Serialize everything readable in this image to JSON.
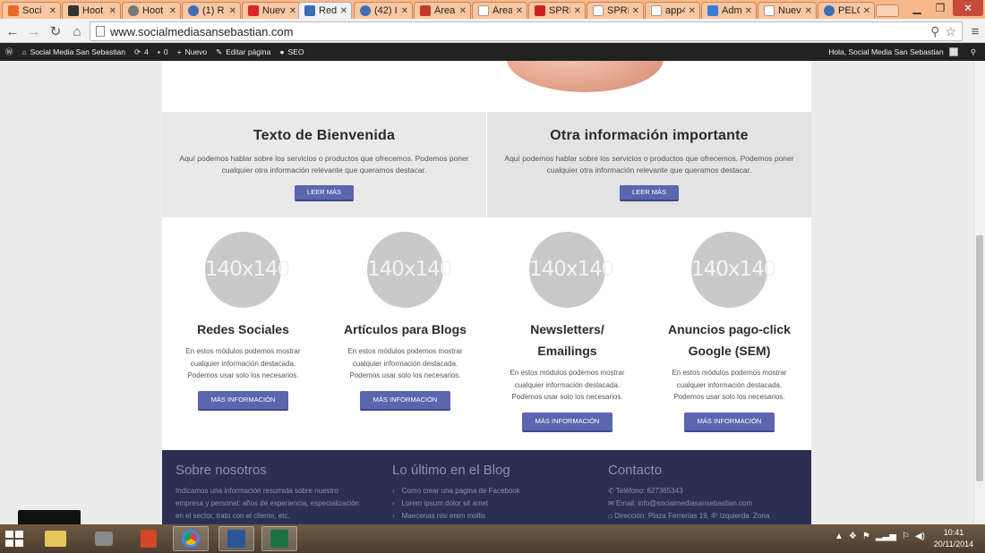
{
  "browser": {
    "tabs": [
      {
        "title": "Soci",
        "color": "#e8692b"
      },
      {
        "title": "Hoot",
        "color": "#333333"
      },
      {
        "title": "Hoot",
        "color": "#777777"
      },
      {
        "title": "(1) R",
        "color": "#3d6fb6"
      },
      {
        "title": "Nuev",
        "color": "#d9262b"
      },
      {
        "title": "Rede",
        "color": "#3d6fb6"
      },
      {
        "title": "(42) I",
        "color": "#3d6fb6"
      },
      {
        "title": "Área",
        "color": "#c0392b"
      },
      {
        "title": "Área",
        "color": "#999999"
      },
      {
        "title": "SPRI",
        "color": "#cc2222"
      },
      {
        "title": "SPRI",
        "color": "#999999"
      },
      {
        "title": "app4",
        "color": "#999999"
      },
      {
        "title": "Adm",
        "color": "#3a7bd5"
      },
      {
        "title": "Nueva p",
        "color": "#999999"
      },
      {
        "title": "PELO",
        "color": "#3d6fb6"
      }
    ],
    "url": "www.socialmediasansebastian.com"
  },
  "adminbar": {
    "site": "Social Media San Sebastian",
    "updates": "4",
    "comments": "0",
    "new": "Nuevo",
    "edit": "Editar página",
    "seo": "SEO",
    "greeting": "Hola, Social Media San Sebastian"
  },
  "intro": [
    {
      "title": "Texto de Bienvenida",
      "text": "Aquí podemos hablar sobre los servicios o productos que ofrecemos. Podemos poner cualquier otra información relevante que queramos destacar.",
      "button": "LEER MÁS"
    },
    {
      "title": "Otra información importante",
      "text": "Aquí podemos hablar sobre los servicios o productos que ofrecemos. Podemos poner cualquier otra información relevante que queramos destacar.",
      "button": "LEER MÁS"
    }
  ],
  "modules": [
    {
      "image": "140x140",
      "title": "Redes Sociales",
      "text": "En estos módulos podemos mostrar cualquier información destacada. Podemos usar solo los necesarios.",
      "button": "MÁS INFORMACIÓN"
    },
    {
      "image": "140x140",
      "title": "Artículos para Blogs",
      "text": "En estos módulos podemos mostrar cualquier información destacada. Podemos usar solo los necesarios.",
      "button": "MÁS INFORMACIÓN"
    },
    {
      "image": "140x140",
      "title": "Newsletters/ Emailings",
      "text": "En estos módulos podemos mostrar cualquier información destacada. Podemos usar solo los necesarios.",
      "button": "MÁS INFORMACIÓN"
    },
    {
      "image": "140x140",
      "title": "Anuncios pago-click Google (SEM)",
      "text": "En estos módulos podemos mostrar cualquier información destacada. Podemos usar solo los necesarios.",
      "button": "MÁS INFORMACIÓN"
    }
  ],
  "footer": {
    "about_title": "Sobre nosotros",
    "about_text": "Indicamos una información resumida sobre nuestro empresa y personal: años de experiencia, especialización en el sector, trato con el cliente, etc.",
    "blog_title": "Lo último en el Blog",
    "blog_items": [
      "Como crear una pagina de Facebook",
      "Lorem ipsum dolor sit amet",
      "Maecenas nisi enim mollis"
    ],
    "contact_title": "Contacto",
    "phone": "Teléfono: 627365343",
    "email": "Email: info@socialmediasansebastian.com",
    "address": "Dirección: Plaza Ferrerías 19, 4º Izquierda. Zona"
  },
  "taskbar": {
    "time": "10:41",
    "date": "20/11/2014"
  },
  "colors": {
    "button": "#5a66ad",
    "footer": "#2b3053",
    "tabstrip": "#f7b98a"
  }
}
